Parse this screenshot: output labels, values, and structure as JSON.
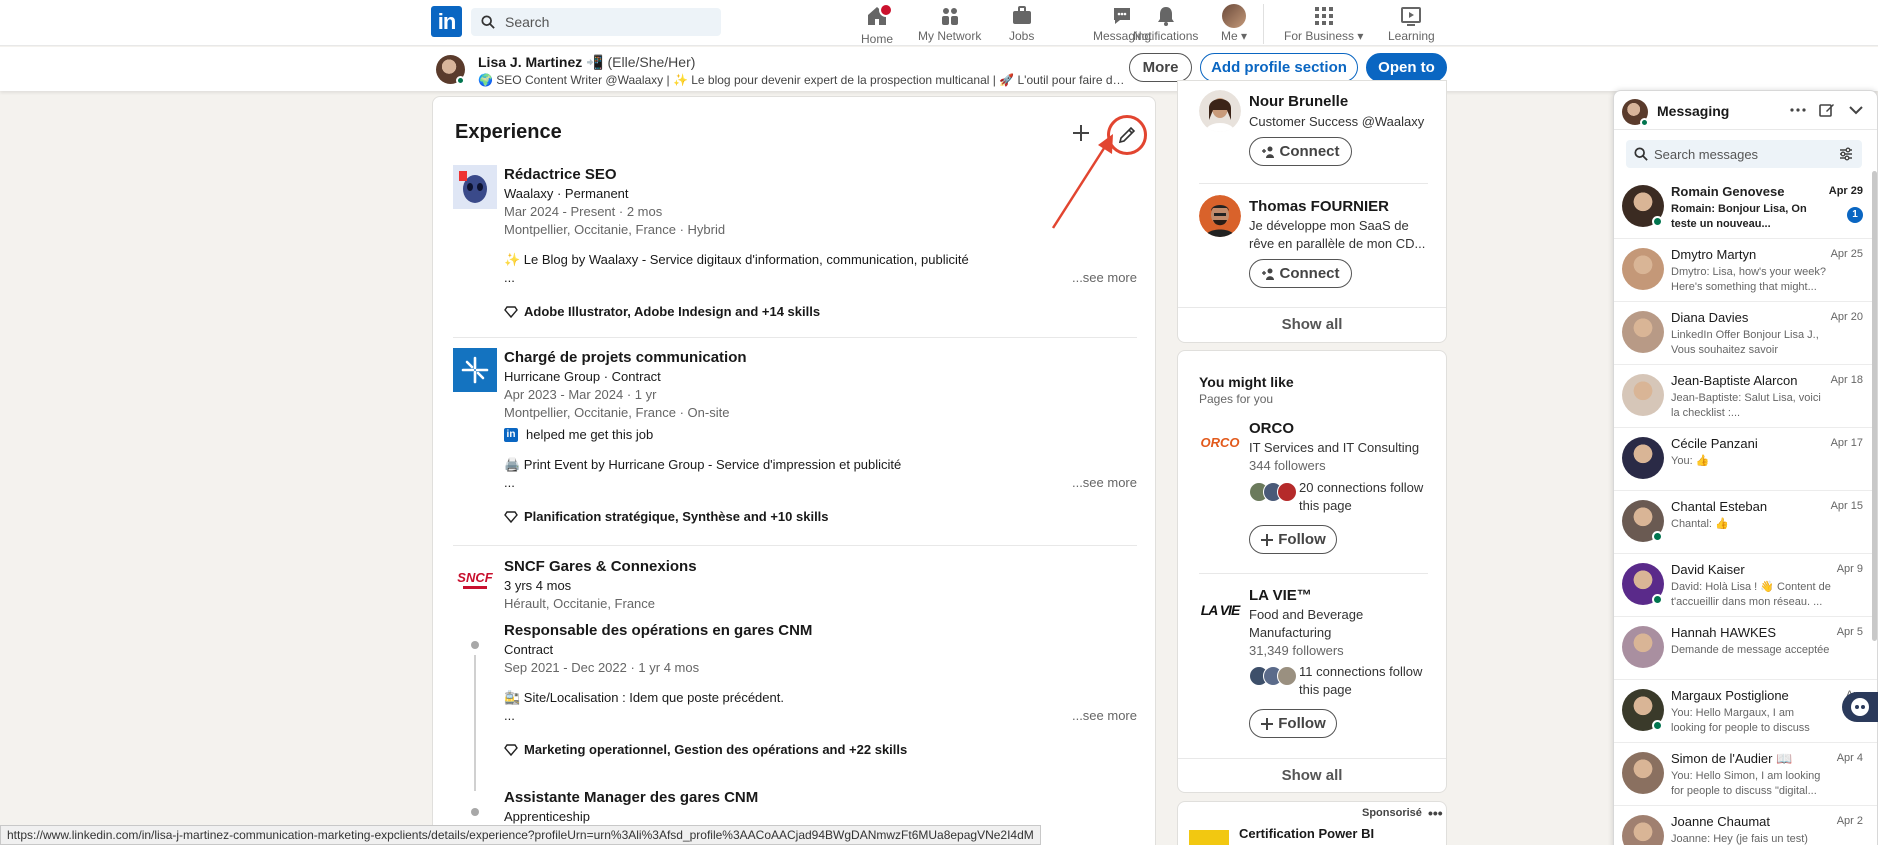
{
  "nav": {
    "search_placeholder": "Search",
    "items": [
      {
        "label": "Home"
      },
      {
        "label": "My Network"
      },
      {
        "label": "Jobs"
      },
      {
        "label": "Messaging"
      },
      {
        "label": "Notifications"
      },
      {
        "label": "Me"
      },
      {
        "label": "For Business"
      },
      {
        "label": "Learning"
      }
    ]
  },
  "profile_bar": {
    "name": "Lisa J. Martinez",
    "pronouns": "(Elle/She/Her)",
    "headline": "🌍 SEO Content Writer @Waalaxy | ✨ Le blog pour devenir expert de la prospection multicanal | 🚀 L'outil pour faire de Linked...",
    "more_label": "More",
    "add_section_label": "Add profile section",
    "open_to_label": "Open to"
  },
  "experience": {
    "title": "Experience",
    "entries": [
      {
        "title": "Rédactrice SEO",
        "company": "Waalaxy · Permanent",
        "dates": "Mar 2024 - Present · 2 mos",
        "location": "Montpellier, Occitanie, France · Hybrid",
        "desc": "✨ Le Blog by Waalaxy - Service digitaux d'information, communication, publicité",
        "desc_more": "...",
        "see_more": "...see more",
        "skills": "Adobe Illustrator, Adobe Indesign and +14 skills"
      },
      {
        "title": "Chargé de projets communication",
        "company": "Hurricane Group · Contract",
        "dates": "Apr 2023 - Mar 2024 · 1 yr",
        "location": "Montpellier, Occitanie, France · On-site",
        "helped": "helped me get this job",
        "desc": "🖨️ Print Event by Hurricane Group - Service d'impression et publicité",
        "desc_more": "...",
        "see_more": "...see more",
        "skills": "Planification stratégique, Synthèse and +10 skills"
      },
      {
        "company": "SNCF Gares & Connexions",
        "duration": "3 yrs 4 mos",
        "location": "Hérault, Occitanie, France",
        "logo_text": "SNCF",
        "roles": [
          {
            "title": "Responsable des opérations en gares CNM",
            "type": "Contract",
            "dates": "Sep 2021 - Dec 2022 · 1 yr 4 mos",
            "desc": "🚉 Site/Localisation : Idem que poste précédent.",
            "desc_more": "...",
            "see_more": "...see more",
            "skills": "Marketing operationnel, Gestion des opérations and +22 skills"
          },
          {
            "title": "Assistante Manager des gares CNM",
            "type": "Apprenticeship"
          }
        ]
      }
    ]
  },
  "people": {
    "items": [
      {
        "name": "Nour Brunelle",
        "headline": "Customer Success @Waalaxy",
        "button": "Connect"
      },
      {
        "name": "Thomas FOURNIER",
        "headline": "Je développe mon SaaS de rêve en parallèle de mon CD...",
        "button": "Connect"
      }
    ],
    "show_all": "Show all"
  },
  "you_might_like": {
    "title": "You might like",
    "subtitle": "Pages for you",
    "pages": [
      {
        "name": "ORCO",
        "logo_text": "ORCO",
        "industry": "IT Services and IT Consulting",
        "followers": "344 followers",
        "connections": "20 connections follow this page",
        "button": "Follow"
      },
      {
        "name": "LA VIE™",
        "logo_text": "LA VIE",
        "industry": "Food and Beverage Manufacturing",
        "followers": "31,349 followers",
        "connections": "11 connections follow this page",
        "button": "Follow"
      }
    ],
    "show_all": "Show all"
  },
  "sponsored": {
    "label": "Sponsorisé",
    "title": "Certification Power BI"
  },
  "messaging": {
    "title": "Messaging",
    "search_placeholder": "Search messages",
    "conversations": [
      {
        "name": "Romain Genovese",
        "date": "Apr 29",
        "preview": "Romain: Bonjour Lisa, On teste un nouveau...",
        "unread": true,
        "badge": "1",
        "online": true
      },
      {
        "name": "Dmytro Martyn",
        "date": "Apr 25",
        "preview": "Dmytro: Lisa, how's your week? Here's something that might...",
        "online": false
      },
      {
        "name": "Diana Davies",
        "date": "Apr 20",
        "preview": "LinkedIn Offer Bonjour Lisa J., Vous souhaitez savoir comment...",
        "online": false
      },
      {
        "name": "Jean-Baptiste Alarcon",
        "date": "Apr 18",
        "preview": "Jean-Baptiste: Salut Lisa, voici la checklist :...",
        "online": false
      },
      {
        "name": "Cécile Panzani",
        "date": "Apr 17",
        "preview": "You: 👍",
        "online": false
      },
      {
        "name": "Chantal Esteban",
        "date": "Apr 15",
        "preview": "Chantal: 👍",
        "online": true
      },
      {
        "name": "David Kaiser",
        "date": "Apr 9",
        "preview": "David: Holà Lisa ! 👋 Content de t'accueillir dans mon réseau. ...",
        "online": true
      },
      {
        "name": "Hannah HAWKES",
        "date": "Apr 5",
        "preview": "Demande de message acceptée",
        "online": false
      },
      {
        "name": "Margaux Postiglione",
        "date": "Apr",
        "preview": "You: Hello Margaux, I am looking for people to discuss \"digital...",
        "online": true
      },
      {
        "name": "Simon de l'Audier 📖",
        "date": "Apr 4",
        "preview": "You: Hello Simon, I am looking for people to discuss \"digital...",
        "online": false
      },
      {
        "name": "Joanne Chaumat",
        "date": "Apr 2",
        "preview": "Joanne: Hey (je fais un test)",
        "online": false
      }
    ]
  },
  "status_url": "https://www.linkedin.com/in/lisa-j-martinez-communication-marketing-expclients/details/experience?profileUrn=urn%3Ali%3Afsd_profile%3AACoAACjad94BWgDANmwzFt6MUa8epagVNe2I4dM",
  "colors": {
    "brand": "#0a66c2",
    "highlight": "#e24530",
    "online": "#01754f",
    "badge": "#cb112d"
  }
}
